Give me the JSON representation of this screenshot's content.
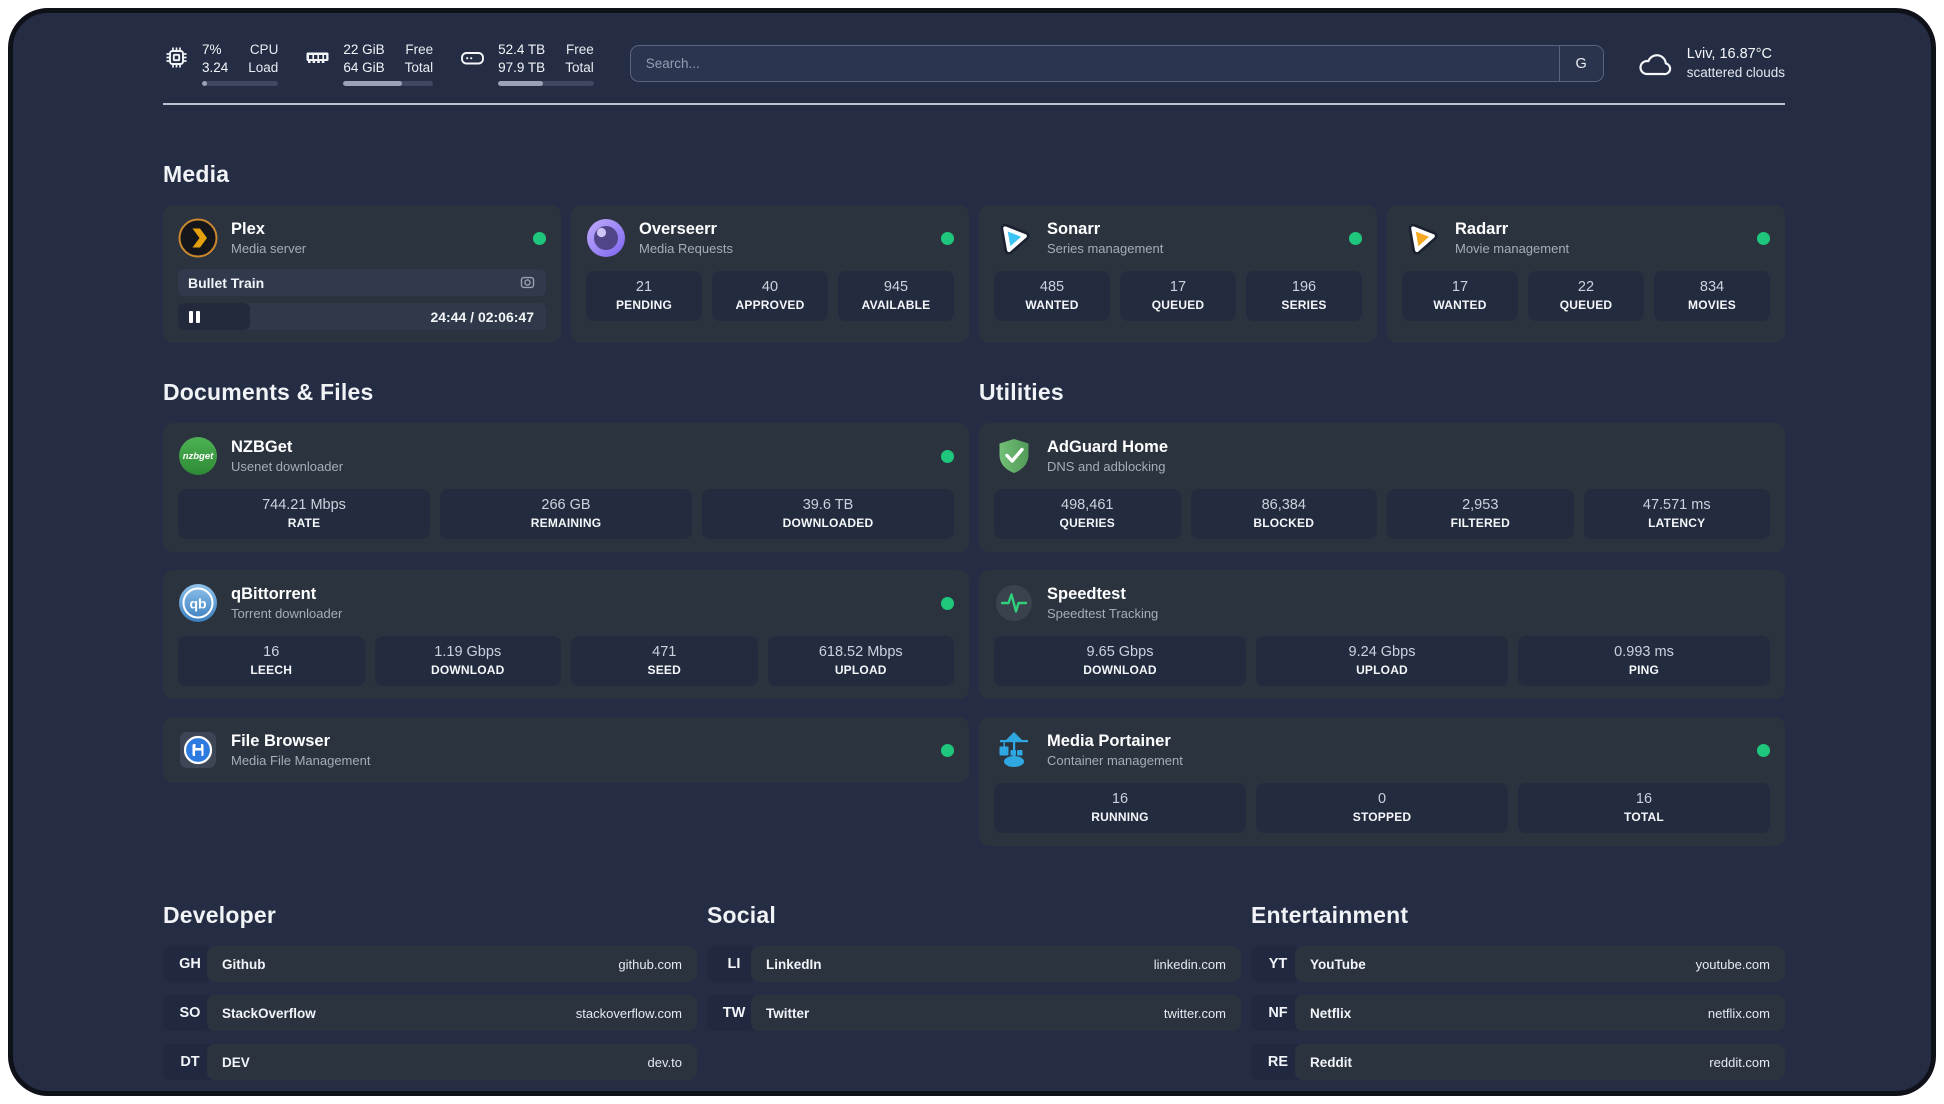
{
  "colors": {
    "status_online": "#1fc77d",
    "background": "#242d43",
    "card": "#2b333f",
    "stat_box": "#232b3e",
    "plex_accent": "#e5a00d"
  },
  "icons": {
    "cpu-icon": "chip outline",
    "ram-icon": "memory stick",
    "disk-icon": "hard drive",
    "search-engine-key": "G",
    "cloud-icon": "cloud outline",
    "pause-icon": "❚❚",
    "camera-icon": "▣ screenshot/photo glyph",
    "status-dot": "●"
  },
  "header": {
    "system_stats": [
      {
        "icon": "cpu-icon",
        "values": [
          "7%",
          "3.24"
        ],
        "labels": [
          "CPU",
          "Load"
        ],
        "progress": "7%"
      },
      {
        "icon": "ram-icon",
        "values": [
          "22 GiB",
          "64 GiB"
        ],
        "labels": [
          "Free",
          "Total"
        ],
        "progress": "65%"
      },
      {
        "icon": "disk-icon",
        "values": [
          "52.4 TB",
          "97.9 TB"
        ],
        "labels": [
          "Free",
          "Total"
        ],
        "progress": "47%"
      }
    ],
    "search": {
      "placeholder": "Search...",
      "engine_key": "G"
    },
    "weather": {
      "icon": "cloud-icon",
      "location_temp": "Lviv, 16.87°C",
      "condition": "scattered clouds"
    }
  },
  "sections": {
    "media": {
      "title": "Media",
      "plex": {
        "icon": "plex-icon",
        "title": "Plex",
        "subtitle": "Media server",
        "status": "online",
        "now_playing": "Bullet Train",
        "time": "24:44 / 02:06:47",
        "progress": "19.5%"
      },
      "overseerr": {
        "icon": "overseerr-icon",
        "title": "Overseerr",
        "subtitle": "Media Requests",
        "status": "online",
        "stats": [
          {
            "value": "21",
            "label": "PENDING"
          },
          {
            "value": "40",
            "label": "APPROVED"
          },
          {
            "value": "945",
            "label": "AVAILABLE"
          }
        ]
      },
      "sonarr": {
        "icon": "sonarr-icon",
        "title": "Sonarr",
        "subtitle": "Series management",
        "status": "online",
        "stats": [
          {
            "value": "485",
            "label": "WANTED"
          },
          {
            "value": "17",
            "label": "QUEUED"
          },
          {
            "value": "196",
            "label": "SERIES"
          }
        ]
      },
      "radarr": {
        "icon": "radarr-icon",
        "title": "Radarr",
        "subtitle": "Movie management",
        "status": "online",
        "stats": [
          {
            "value": "17",
            "label": "WANTED"
          },
          {
            "value": "22",
            "label": "QUEUED"
          },
          {
            "value": "834",
            "label": "MOVIES"
          }
        ]
      }
    },
    "documents": {
      "title": "Documents & Files",
      "nzbget": {
        "icon": "nzbget-icon",
        "icon_text": "nzbget",
        "title": "NZBGet",
        "subtitle": "Usenet downloader",
        "status": "online",
        "stats": [
          {
            "value": "744.21 Mbps",
            "label": "RATE"
          },
          {
            "value": "266 GB",
            "label": "REMAINING"
          },
          {
            "value": "39.6 TB",
            "label": "DOWNLOADED"
          }
        ]
      },
      "qbittorrent": {
        "icon": "qbittorrent-icon",
        "icon_text": "qb",
        "title": "qBittorrent",
        "subtitle": "Torrent downloader",
        "status": "online",
        "stats": [
          {
            "value": "16",
            "label": "LEECH"
          },
          {
            "value": "1.19 Gbps",
            "label": "DOWNLOAD"
          },
          {
            "value": "471",
            "label": "SEED"
          },
          {
            "value": "618.52 Mbps",
            "label": "UPLOAD"
          }
        ]
      },
      "filebrowser": {
        "icon": "filebrowser-icon",
        "title": "File Browser",
        "subtitle": "Media File Management",
        "status": "online"
      }
    },
    "utilities": {
      "title": "Utilities",
      "adguard": {
        "icon": "adguard-icon",
        "title": "AdGuard Home",
        "subtitle": "DNS and adblocking",
        "stats": [
          {
            "value": "498,461",
            "label": "QUERIES"
          },
          {
            "value": "86,384",
            "label": "BLOCKED"
          },
          {
            "value": "2,953",
            "label": "FILTERED"
          },
          {
            "value": "47.571 ms",
            "label": "LATENCY"
          }
        ]
      },
      "speedtest": {
        "icon": "speedtest-icon",
        "title": "Speedtest",
        "subtitle": "Speedtest Tracking",
        "stats": [
          {
            "value": "9.65 Gbps",
            "label": "DOWNLOAD"
          },
          {
            "value": "9.24 Gbps",
            "label": "UPLOAD"
          },
          {
            "value": "0.993 ms",
            "label": "PING"
          }
        ]
      },
      "portainer": {
        "icon": "portainer-icon",
        "title": "Media Portainer",
        "subtitle": "Container management",
        "status": "online",
        "stats": [
          {
            "value": "16",
            "label": "RUNNING"
          },
          {
            "value": "0",
            "label": "STOPPED"
          },
          {
            "value": "16",
            "label": "TOTAL"
          }
        ]
      }
    },
    "developer": {
      "title": "Developer",
      "links": [
        {
          "code": "GH",
          "name": "Github",
          "url": "github.com"
        },
        {
          "code": "SO",
          "name": "StackOverflow",
          "url": "stackoverflow.com"
        },
        {
          "code": "DT",
          "name": "DEV",
          "url": "dev.to"
        }
      ]
    },
    "social": {
      "title": "Social",
      "links": [
        {
          "code": "LI",
          "name": "LinkedIn",
          "url": "linkedin.com"
        },
        {
          "code": "TW",
          "name": "Twitter",
          "url": "twitter.com"
        }
      ]
    },
    "entertainment": {
      "title": "Entertainment",
      "links": [
        {
          "code": "YT",
          "name": "YouTube",
          "url": "youtube.com"
        },
        {
          "code": "NF",
          "name": "Netflix",
          "url": "netflix.com"
        },
        {
          "code": "RE",
          "name": "Reddit",
          "url": "reddit.com"
        }
      ]
    }
  }
}
